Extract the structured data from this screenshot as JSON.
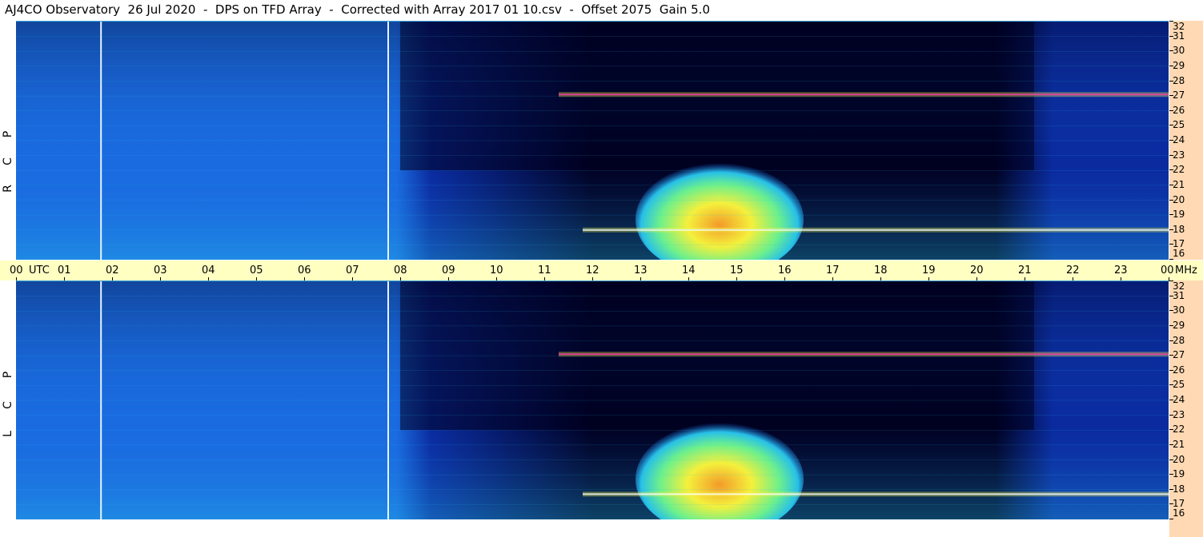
{
  "title": "AJ4CO Observatory  26 Jul 2020  -  DPS on TFD Array  -  Corrected with Array 2017 01 10.csv  -  Offset 2075  Gain 5.0",
  "panels": [
    {
      "pol_letters": [
        "P",
        "C",
        "R"
      ]
    },
    {
      "pol_letters": [
        "P",
        "C",
        "L"
      ]
    }
  ],
  "time_axis": {
    "labels": [
      "00",
      "UTC",
      "01",
      "02",
      "03",
      "04",
      "05",
      "06",
      "07",
      "08",
      "09",
      "10",
      "11",
      "12",
      "13",
      "14",
      "15",
      "16",
      "17",
      "18",
      "19",
      "20",
      "21",
      "22",
      "23",
      "00",
      "MHz"
    ]
  },
  "chart_data": [
    {
      "type": "heatmap",
      "panel": "RCP",
      "x_unit": "UTC hour",
      "xlim": [
        0,
        24
      ],
      "y_unit": "MHz",
      "ylim": [
        16,
        32
      ],
      "y_ticks": [
        32,
        31,
        30,
        29,
        28,
        27,
        26,
        25,
        24,
        23,
        22,
        21,
        20,
        19,
        18,
        17,
        16
      ],
      "x_ticks": [
        "00",
        "01",
        "02",
        "03",
        "04",
        "05",
        "06",
        "07",
        "08",
        "09",
        "10",
        "11",
        "12",
        "13",
        "14",
        "15",
        "16",
        "17",
        "18",
        "19",
        "20",
        "21",
        "22",
        "23",
        "00"
      ],
      "colormap": [
        "#000020",
        "#0a2a9e",
        "#1a6be0",
        "#27c0e8",
        "#6cf08c",
        "#f4f03c",
        "#f39a2a",
        "#ff3aa8",
        "#ffffff"
      ],
      "features": [
        {
          "kind": "marker_line",
          "x_hour": 1.77,
          "color": "#e8f4ff"
        },
        {
          "kind": "marker_line",
          "x_hour": 7.75,
          "color": "#e8f4ff"
        },
        {
          "kind": "solar_burst_region",
          "x_range_hour": [
            12.9,
            16.4
          ],
          "y_range_mhz": [
            16,
            22.5
          ],
          "peak_color": "#f39a2a"
        },
        {
          "kind": "interference_band",
          "y_mhz": 27.1,
          "x_range_hour": [
            11.3,
            24
          ],
          "color": "#ff3aa8"
        },
        {
          "kind": "interference_band",
          "y_mhz": 18.0,
          "x_range_hour": [
            11.8,
            24
          ],
          "color": "#ffffff"
        },
        {
          "kind": "quiet_night_region",
          "x_range_hour": [
            8.0,
            21.2
          ],
          "y_range_mhz": [
            22,
            32
          ],
          "color": "#000020"
        }
      ]
    },
    {
      "type": "heatmap",
      "panel": "LCP",
      "x_unit": "UTC hour",
      "xlim": [
        0,
        24
      ],
      "y_unit": "MHz",
      "ylim": [
        16,
        32
      ],
      "y_ticks": [
        32,
        31,
        30,
        29,
        28,
        27,
        26,
        25,
        24,
        23,
        22,
        21,
        20,
        19,
        18,
        17,
        16
      ],
      "x_ticks": [
        "00",
        "01",
        "02",
        "03",
        "04",
        "05",
        "06",
        "07",
        "08",
        "09",
        "10",
        "11",
        "12",
        "13",
        "14",
        "15",
        "16",
        "17",
        "18",
        "19",
        "20",
        "21",
        "22",
        "23",
        "00"
      ],
      "colormap": [
        "#000020",
        "#0a2a9e",
        "#1a6be0",
        "#27c0e8",
        "#6cf08c",
        "#f4f03c",
        "#f39a2a",
        "#ff3aa8",
        "#ffffff"
      ],
      "features": [
        {
          "kind": "marker_line",
          "x_hour": 1.77,
          "color": "#e8f4ff"
        },
        {
          "kind": "marker_line",
          "x_hour": 7.75,
          "color": "#e8f4ff"
        },
        {
          "kind": "solar_burst_region",
          "x_range_hour": [
            12.9,
            16.4
          ],
          "y_range_mhz": [
            16,
            22.5
          ],
          "peak_color": "#f39a2a"
        },
        {
          "kind": "interference_band",
          "y_mhz": 27.1,
          "x_range_hour": [
            11.3,
            24
          ],
          "color": "#ff3aa8"
        },
        {
          "kind": "interference_band",
          "y_mhz": 17.7,
          "x_range_hour": [
            11.8,
            24
          ],
          "color": "#ffffff"
        },
        {
          "kind": "quiet_night_region",
          "x_range_hour": [
            8.0,
            21.2
          ],
          "y_range_mhz": [
            22,
            32
          ],
          "color": "#000020"
        }
      ]
    }
  ]
}
